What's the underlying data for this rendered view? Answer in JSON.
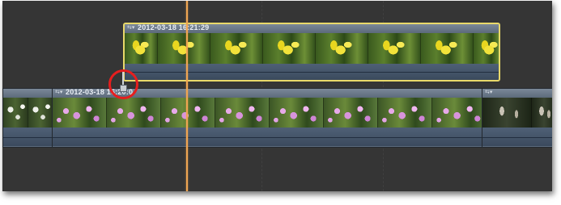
{
  "timeline": {
    "connected_clip": {
      "title": "2012-03-18 16:21:29",
      "menu_icon": "clip-menu-icon",
      "selected": true,
      "accent_color": "#e9d96a"
    },
    "primary_clips": [
      {
        "title": "",
        "thumb_style": "white-thumb"
      },
      {
        "title": "2012-03-18 16:20:0",
        "thumb_style": "pink-thumb"
      },
      {
        "title": "",
        "thumb_style": "dark-thumb"
      }
    ],
    "playhead_color": "#f0a552",
    "highlight_circle_color": "#e61e1e"
  }
}
